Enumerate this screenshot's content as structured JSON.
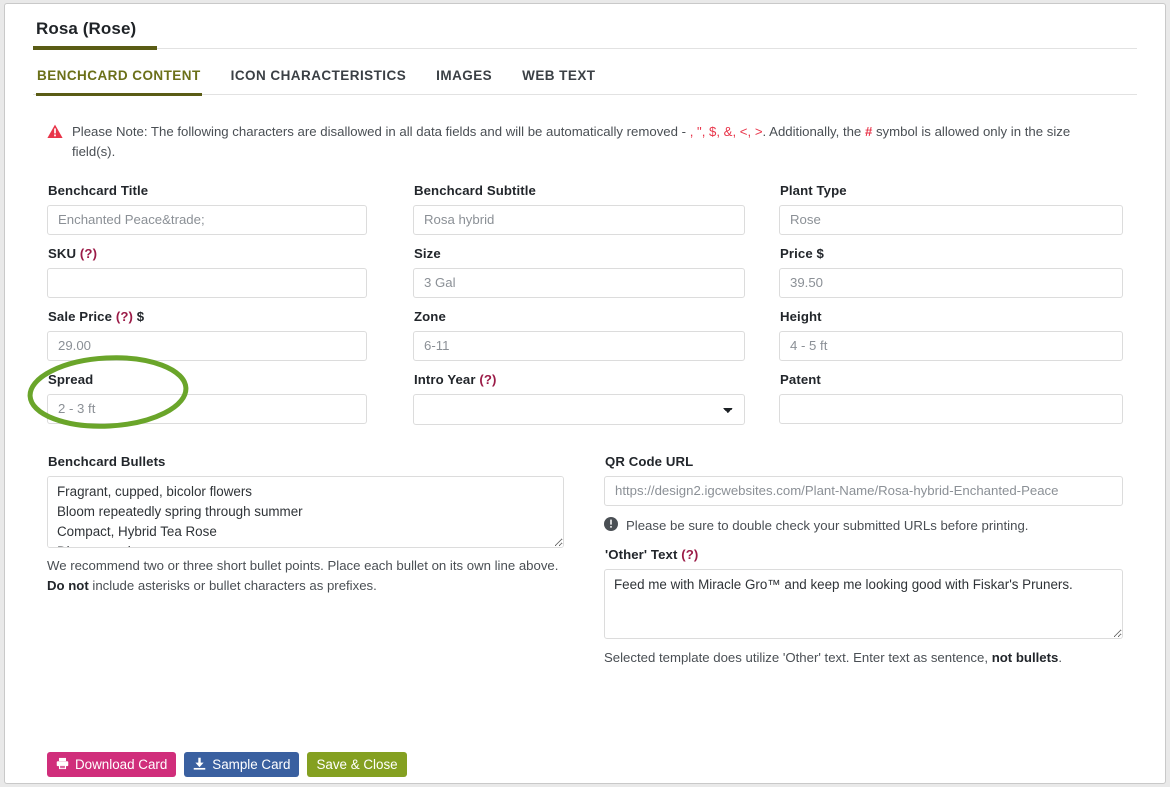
{
  "header": {
    "title": "Rosa (Rose)"
  },
  "tabs": [
    {
      "label": "BENCHCARD CONTENT",
      "active": true
    },
    {
      "label": "ICON CHARACTERISTICS",
      "active": false
    },
    {
      "label": "IMAGES",
      "active": false
    },
    {
      "label": "WEB TEXT",
      "active": false
    }
  ],
  "note": {
    "icon": "warning-triangle-icon",
    "part1": "Please Note: The following characters are disallowed in all data fields and will be automatically removed - ",
    "chars": ", \", $, &, <, >",
    "part2": ". Additionally, the ",
    "hash": "#",
    "part3": " symbol is allowed only in the size field(s).",
    "accent_color": "#e8354a"
  },
  "fields": {
    "benchcard_title": {
      "label": "Benchcard Title",
      "value": "",
      "placeholder": "Enchanted Peace&trade;"
    },
    "benchcard_subtitle": {
      "label": "Benchcard Subtitle",
      "value": "",
      "placeholder": "Rosa hybrid"
    },
    "plant_type": {
      "label": "Plant Type",
      "value": "",
      "placeholder": "Rose"
    },
    "sku": {
      "label": "SKU",
      "help": "(?)",
      "value": "",
      "placeholder": ""
    },
    "size": {
      "label": "Size",
      "value": "",
      "placeholder": "3 Gal"
    },
    "price": {
      "label": "Price $",
      "value": "",
      "placeholder": "39.50"
    },
    "sale_price": {
      "label": "Sale Price",
      "help": "(?)",
      "suffix": "$",
      "value": "",
      "placeholder": "29.00"
    },
    "zone": {
      "label": "Zone",
      "value": "",
      "placeholder": "6-11"
    },
    "height": {
      "label": "Height",
      "value": "",
      "placeholder": "4 - 5 ft"
    },
    "spread": {
      "label": "Spread",
      "value": "",
      "placeholder": "2 - 3 ft"
    },
    "intro_year": {
      "label": "Intro Year",
      "help": "(?)",
      "selected": "",
      "options": [
        ""
      ]
    },
    "patent": {
      "label": "Patent",
      "value": "",
      "placeholder": ""
    },
    "benchcard_bullets": {
      "label": "Benchcard Bullets",
      "value": "Fragrant, cupped, bicolor flowers\nBloom repeatedly spring through summer\nCompact, Hybrid Tea Rose\nDisease resistant",
      "helper_1": "We recommend two or three short bullet points. Place each bullet on its own line above. ",
      "helper_bold": "Do not",
      "helper_2": " include asterisks or bullet characters as prefixes."
    },
    "qr_code_url": {
      "label": "QR Code URL",
      "value": "",
      "placeholder": "https://design2.igcwebsites.com/Plant-Name/Rosa-hybrid-Enchanted-Peace",
      "note_icon": "info-circle-icon",
      "note": "Please be sure to double check your submitted URLs before printing."
    },
    "other_text": {
      "label": "'Other' Text",
      "help": "(?)",
      "value": "Feed me with Miracle Gro™ and keep me looking good with Fiskar's Pruners.",
      "helper_1": "Selected template does utilize 'Other' text. Enter text as sentence, ",
      "helper_bold": "not bullets",
      "helper_2": "."
    }
  },
  "buttons": {
    "download": {
      "label": "Download Card",
      "icon": "printer-icon",
      "color": "#d02e7b"
    },
    "sample": {
      "label": "Sample Card",
      "icon": "download-icon",
      "color": "#3a60a0"
    },
    "save": {
      "label": "Save & Close",
      "color": "#84a021"
    }
  },
  "annotation": {
    "shape": "ellipse-highlight",
    "target": "sale-price-field",
    "color": "#6aa52a"
  }
}
